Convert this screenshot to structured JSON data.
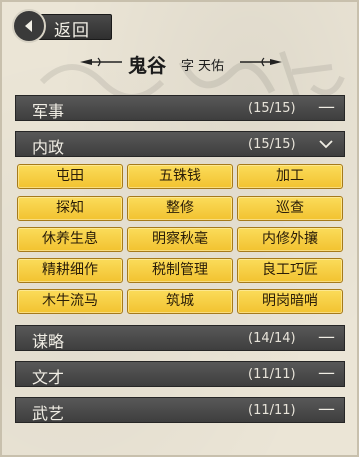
{
  "header": {
    "back_label": "返回",
    "name": "鬼谷",
    "zi_label": "字",
    "courtesy_name": "天佑"
  },
  "sections": [
    {
      "label": "军事",
      "count": "(15/15)",
      "state": "collapsed"
    },
    {
      "label": "内政",
      "count": "(15/15)",
      "state": "expanded"
    },
    {
      "label": "谋略",
      "count": "(14/14)",
      "state": "collapsed"
    },
    {
      "label": "文才",
      "count": "(11/11)",
      "state": "collapsed"
    },
    {
      "label": "武艺",
      "count": "(11/11)",
      "state": "collapsed"
    }
  ],
  "skills": [
    "屯田",
    "五铢钱",
    "加工",
    "探知",
    "整修",
    "巡查",
    "休养生息",
    "明察秋毫",
    "内修外攘",
    "精耕细作",
    "税制管理",
    "良工巧匠",
    "木牛流马",
    "筑城",
    "明岗暗哨"
  ],
  "colors": {
    "bar_bg": "#4a4a4a",
    "button_gold": "#f6cc3c",
    "paper": "#ebe5d6"
  }
}
